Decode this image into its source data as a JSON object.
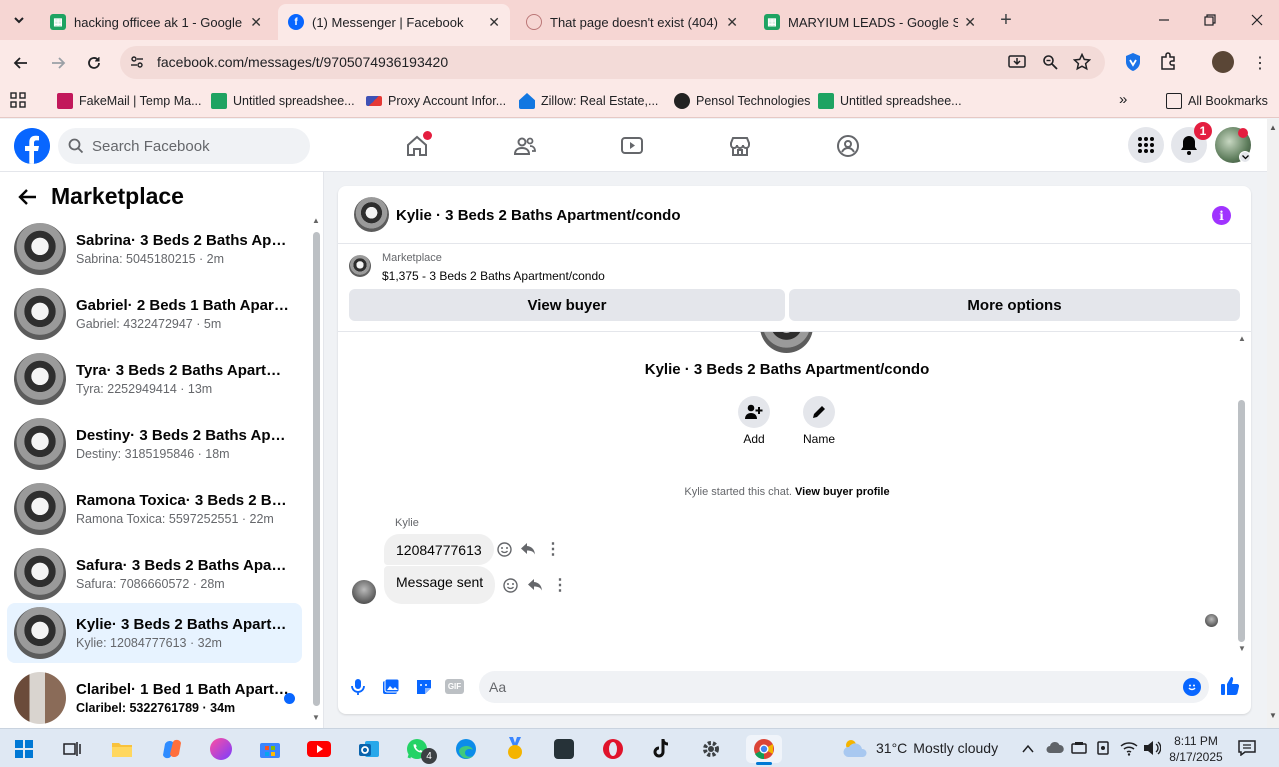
{
  "browser": {
    "tabs": [
      {
        "title": "hacking officee ak 1 - Google D",
        "icon": "sheets-icon",
        "active": false
      },
      {
        "title": "(1) Messenger | Facebook",
        "icon": "facebook-icon",
        "active": true
      },
      {
        "title": "That page doesn't exist (404) - F",
        "icon": "globe-icon",
        "active": false
      },
      {
        "title": "MARYIUM LEADS - Google She",
        "icon": "sheets-icon",
        "active": false
      }
    ],
    "url": "facebook.com/messages/t/9705074936193420",
    "bookmarks": [
      {
        "label": "FakeMail | Temp Ma...",
        "icon": "mail-icon"
      },
      {
        "label": "Untitled spreadshee...",
        "icon": "sheets-icon"
      },
      {
        "label": "Proxy Account Infor...",
        "icon": "proxy-icon"
      },
      {
        "label": "Zillow: Real Estate,...",
        "icon": "zillow-icon"
      },
      {
        "label": "Pensol Technologies",
        "icon": "pensol-icon"
      },
      {
        "label": "Untitled spreadshee...",
        "icon": "sheets-icon"
      }
    ],
    "all_bookmarks": "All Bookmarks"
  },
  "fb": {
    "search_placeholder": "Search Facebook",
    "notifications_count": "1",
    "brand_color": "#0866ff"
  },
  "sidebar": {
    "title": "Marketplace",
    "conversations": [
      {
        "name": "Sabrina· 3 Beds 2 Baths Apartm...",
        "meta": "Sabrina: 5045180215 · 2m",
        "unread": false,
        "selected": false
      },
      {
        "name": "Gabriel· 2 Beds 1 Bath Apartmen...",
        "meta": "Gabriel: 4322472947 · 5m",
        "unread": false,
        "selected": false
      },
      {
        "name": "Tyra· 3 Beds 2 Baths Apartment...",
        "meta": "Tyra: 2252949414 · 13m",
        "unread": false,
        "selected": false
      },
      {
        "name": "Destiny· 3 Beds 2 Baths Apartm...",
        "meta": "Destiny: 3185195846 · 18m",
        "unread": false,
        "selected": false
      },
      {
        "name": "Ramona Toxica· 3 Beds 2 Baths ...",
        "meta": "Ramona Toxica: 5597252551 · 22m",
        "unread": false,
        "selected": false
      },
      {
        "name": "Safura· 3 Beds 2 Baths Apartme...",
        "meta": "Safura: 7086660572 · 28m",
        "unread": false,
        "selected": false
      },
      {
        "name": "Kylie· 3 Beds 2 Baths Apartment...",
        "meta": "Kylie: 12084777613 · 32m",
        "unread": false,
        "selected": true
      },
      {
        "name": "Claribel· 1 Bed 1 Bath Apartme...",
        "meta": "Claribel: 5322761789 · 34m",
        "unread": true,
        "selected": false
      }
    ]
  },
  "chat": {
    "header_title": "Kylie · 3 Beds 2 Baths Apartment/condo",
    "listing_label": "Marketplace",
    "listing_text": "$1,375 - 3 Beds 2 Baths Apartment/condo",
    "view_buyer": "View buyer",
    "more_options": "More options",
    "profile_title": "Kylie · 3 Beds 2 Baths Apartment/condo",
    "add_label": "Add",
    "name_label": "Name",
    "started_text": "Kylie started this chat.",
    "view_profile_link": "View buyer profile",
    "sender_name": "Kylie",
    "messages": [
      {
        "text": "12084777613"
      },
      {
        "text": "Message sent"
      }
    ],
    "composer_placeholder": "Aa",
    "accent_color": "#0866ff",
    "info_color": "#a033ff"
  },
  "taskbar": {
    "weather_temp": "31°C",
    "weather_text": "Mostly cloudy",
    "time": "8:11 PM",
    "date": "8/17/2025",
    "whatsapp_badge": "4"
  }
}
